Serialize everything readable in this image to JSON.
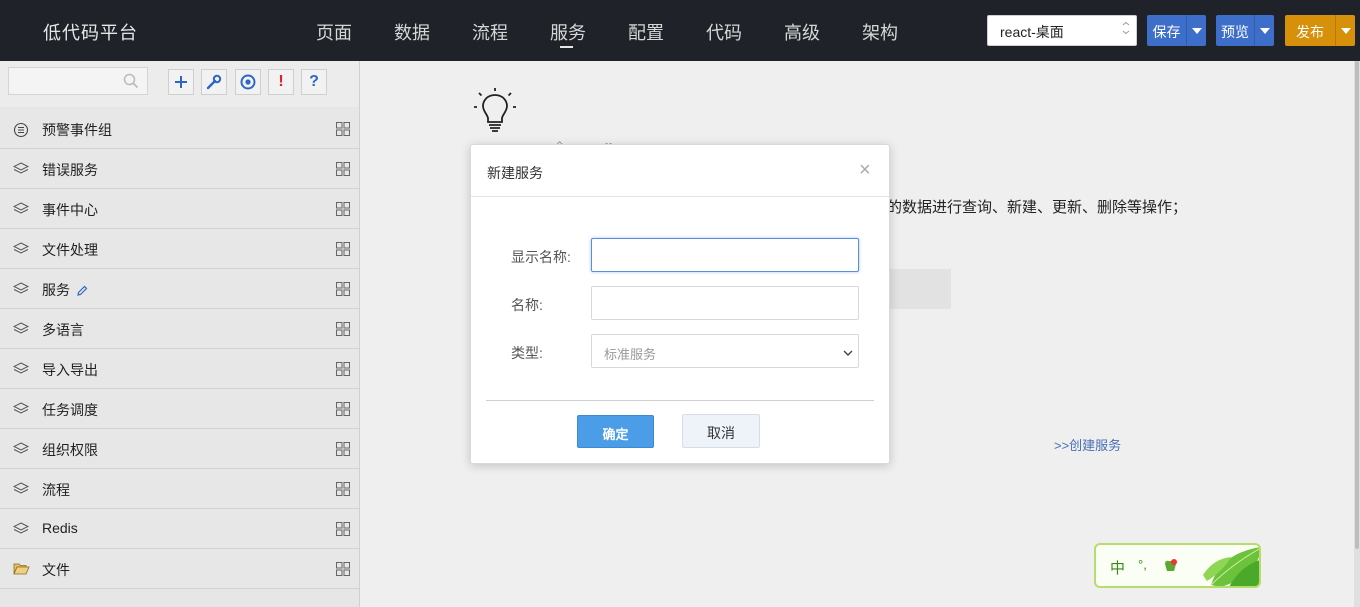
{
  "header": {
    "brand": "低代码平台",
    "nav": [
      "页面",
      "数据",
      "流程",
      "服务",
      "配置",
      "代码",
      "高级",
      "架构"
    ],
    "active_nav": "服务",
    "env_select": "react-桌面",
    "save_label": "保存",
    "preview_label": "预览",
    "publish_label": "发布",
    "colors": {
      "bar": "#1f2329",
      "save": "#3d6ec9",
      "preview": "#3d6ec9",
      "publish": "#d6900a"
    }
  },
  "sidebar": {
    "search_placeholder": "",
    "tools": [
      "plus-icon",
      "wrench-icon",
      "target-icon",
      "exclamation-icon",
      "question-icon"
    ],
    "items": [
      {
        "label": "预警事件组",
        "icon": "list-circle-icon"
      },
      {
        "label": "错误服务",
        "icon": "layers-icon"
      },
      {
        "label": "事件中心",
        "icon": "layers-icon"
      },
      {
        "label": "文件处理",
        "icon": "layers-icon"
      },
      {
        "label": "服务",
        "icon": "layers-icon",
        "editing": true
      },
      {
        "label": "多语言",
        "icon": "layers-icon"
      },
      {
        "label": "导入导出",
        "icon": "layers-icon"
      },
      {
        "label": "任务调度",
        "icon": "layers-icon"
      },
      {
        "label": "组织权限",
        "icon": "layers-icon"
      },
      {
        "label": "流程",
        "icon": "layers-icon"
      },
      {
        "label": "Redis",
        "icon": "layers-icon"
      },
      {
        "label": "文件",
        "icon": "folder-open-icon"
      }
    ]
  },
  "main": {
    "description": "的数据进行查询、新建、更新、删除等操作；",
    "create_link": ">>创建服务"
  },
  "modal": {
    "title": "新建服务",
    "close": "×",
    "display_name_label": "显示名称:",
    "display_name_value": "",
    "name_label": "名称:",
    "name_value": "",
    "type_label": "类型:",
    "type_value": "标准服务",
    "ok_label": "确定",
    "cancel_label": "取消"
  },
  "ime": {
    "mode": "中",
    "punct": "°,"
  }
}
